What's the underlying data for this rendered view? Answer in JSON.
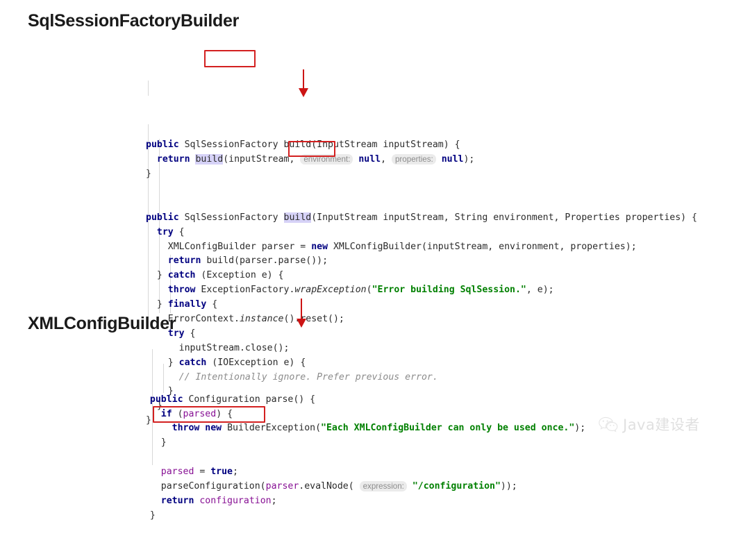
{
  "page": {
    "watermark_text": "Java建设者",
    "watermark_icon": "wechat-logo-icon",
    "accent_color": "#cc1414",
    "annotation_box_color": "#d32020",
    "keyword_color": "#000080",
    "string_color": "#008000",
    "comment_color": "#8c8c8c",
    "field_color": "#871094",
    "highlight_color": "#d6d2f7",
    "inlay_hint_bg": "#ebebeb",
    "background_color": "#ffffff"
  },
  "sections": [
    {
      "id": "sqlsessionfactorybuilder",
      "title": "SqlSessionFactoryBuilder"
    },
    {
      "id": "xmlconfigbuilder",
      "title": "XMLConfigBuilder"
    }
  ],
  "annotations": {
    "box_build": "build(i",
    "box_parse": "parse()",
    "box_parse_configuration": "parseConfiguration",
    "arrow_1": "build-method-overload-arrow",
    "arrow_2": "parse-method-arrow"
  },
  "code_factory": {
    "lines": [
      {
        "tokens": [
          {
            "t": "public",
            "c": "kw"
          },
          {
            "t": " SqlSessionFactory build(InputStream inputStream) {",
            "c": "plain"
          }
        ]
      },
      {
        "tokens": [
          {
            "t": "  ",
            "c": "plain"
          },
          {
            "t": "return",
            "c": "kw"
          },
          {
            "t": " ",
            "c": "plain"
          },
          {
            "t": "build",
            "c": "hl-build"
          },
          {
            "t": "(inputStream, ",
            "c": "plain"
          },
          {
            "t": "environment:",
            "c": "hint"
          },
          {
            "t": " ",
            "c": "plain"
          },
          {
            "t": "null",
            "c": "kw"
          },
          {
            "t": ", ",
            "c": "plain"
          },
          {
            "t": "properties:",
            "c": "hint"
          },
          {
            "t": " ",
            "c": "plain"
          },
          {
            "t": "null",
            "c": "kw"
          },
          {
            "t": ");",
            "c": "plain"
          }
        ]
      },
      {
        "tokens": [
          {
            "t": "}",
            "c": "plain"
          }
        ]
      },
      {
        "tokens": [
          {
            "t": "",
            "c": "plain"
          }
        ]
      },
      {
        "tokens": [
          {
            "t": "",
            "c": "plain"
          }
        ]
      },
      {
        "tokens": [
          {
            "t": "public",
            "c": "kw"
          },
          {
            "t": " SqlSessionFactory ",
            "c": "plain"
          },
          {
            "t": "build",
            "c": "hl-build"
          },
          {
            "t": "(InputStream inputStream, String environment, Properties properties) {",
            "c": "plain"
          }
        ]
      },
      {
        "tokens": [
          {
            "t": "  ",
            "c": "plain"
          },
          {
            "t": "try",
            "c": "kw"
          },
          {
            "t": " {",
            "c": "plain"
          }
        ]
      },
      {
        "tokens": [
          {
            "t": "    XMLConfigBuilder parser = ",
            "c": "plain"
          },
          {
            "t": "new",
            "c": "kw"
          },
          {
            "t": " XMLConfigBuilder(inputStream, environment, properties);",
            "c": "plain"
          }
        ]
      },
      {
        "tokens": [
          {
            "t": "    ",
            "c": "plain"
          },
          {
            "t": "return",
            "c": "kw"
          },
          {
            "t": " build(parser.parse());",
            "c": "plain"
          }
        ]
      },
      {
        "tokens": [
          {
            "t": "  } ",
            "c": "plain"
          },
          {
            "t": "catch",
            "c": "kw"
          },
          {
            "t": " (Exception e) {",
            "c": "plain"
          }
        ]
      },
      {
        "tokens": [
          {
            "t": "    ",
            "c": "plain"
          },
          {
            "t": "throw",
            "c": "kw"
          },
          {
            "t": " ExceptionFactory.",
            "c": "plain"
          },
          {
            "t": "wrapException",
            "c": "mtd-i"
          },
          {
            "t": "(",
            "c": "plain"
          },
          {
            "t": "\"Error building SqlSession.\"",
            "c": "str"
          },
          {
            "t": ", e);",
            "c": "plain"
          }
        ]
      },
      {
        "tokens": [
          {
            "t": "  } ",
            "c": "plain"
          },
          {
            "t": "finally",
            "c": "kw"
          },
          {
            "t": " {",
            "c": "plain"
          }
        ]
      },
      {
        "tokens": [
          {
            "t": "    ErrorContext.",
            "c": "plain"
          },
          {
            "t": "instance",
            "c": "mtd-i"
          },
          {
            "t": "().reset();",
            "c": "plain"
          }
        ]
      },
      {
        "tokens": [
          {
            "t": "    ",
            "c": "plain"
          },
          {
            "t": "try",
            "c": "kw"
          },
          {
            "t": " {",
            "c": "plain"
          }
        ]
      },
      {
        "tokens": [
          {
            "t": "      inputStream.close();",
            "c": "plain"
          }
        ]
      },
      {
        "tokens": [
          {
            "t": "    } ",
            "c": "plain"
          },
          {
            "t": "catch",
            "c": "kw"
          },
          {
            "t": " (IOException e) {",
            "c": "plain"
          }
        ]
      },
      {
        "tokens": [
          {
            "t": "      ",
            "c": "plain"
          },
          {
            "t": "// Intentionally ignore. Prefer previous error.",
            "c": "cmt"
          }
        ]
      },
      {
        "tokens": [
          {
            "t": "    }",
            "c": "plain"
          }
        ]
      },
      {
        "tokens": [
          {
            "t": "  }",
            "c": "plain"
          }
        ]
      },
      {
        "tokens": [
          {
            "t": "}",
            "c": "plain"
          }
        ]
      }
    ]
  },
  "code_config": {
    "lines": [
      {
        "tokens": [
          {
            "t": "  ",
            "c": "plain"
          },
          {
            "t": "public",
            "c": "kw"
          },
          {
            "t": " Configuration parse() {",
            "c": "plain"
          }
        ]
      },
      {
        "tokens": [
          {
            "t": "    ",
            "c": "plain"
          },
          {
            "t": "if",
            "c": "kw"
          },
          {
            "t": " (",
            "c": "plain"
          },
          {
            "t": "parsed",
            "c": "fld"
          },
          {
            "t": ") {",
            "c": "plain"
          }
        ]
      },
      {
        "tokens": [
          {
            "t": "      ",
            "c": "plain"
          },
          {
            "t": "throw",
            "c": "kw"
          },
          {
            "t": " ",
            "c": "plain"
          },
          {
            "t": "new",
            "c": "kw"
          },
          {
            "t": " BuilderException(",
            "c": "plain"
          },
          {
            "t": "\"Each XMLConfigBuilder can only be used once.\"",
            "c": "str"
          },
          {
            "t": ");",
            "c": "plain"
          }
        ]
      },
      {
        "tokens": [
          {
            "t": "    }",
            "c": "plain"
          }
        ]
      },
      {
        "tokens": [
          {
            "t": "",
            "c": "plain"
          }
        ]
      },
      {
        "tokens": [
          {
            "t": "    ",
            "c": "plain"
          },
          {
            "t": "parsed",
            "c": "fld"
          },
          {
            "t": " = ",
            "c": "plain"
          },
          {
            "t": "true",
            "c": "kw"
          },
          {
            "t": ";",
            "c": "plain"
          }
        ]
      },
      {
        "tokens": [
          {
            "t": "    parseConfiguration(",
            "c": "plain"
          },
          {
            "t": "parser",
            "c": "fld"
          },
          {
            "t": ".evalNode( ",
            "c": "plain"
          },
          {
            "t": "expression:",
            "c": "hint"
          },
          {
            "t": " ",
            "c": "plain"
          },
          {
            "t": "\"/configuration\"",
            "c": "str"
          },
          {
            "t": "));",
            "c": "plain"
          }
        ]
      },
      {
        "tokens": [
          {
            "t": "    ",
            "c": "plain"
          },
          {
            "t": "return",
            "c": "kw"
          },
          {
            "t": " ",
            "c": "plain"
          },
          {
            "t": "configuration",
            "c": "fld"
          },
          {
            "t": ";",
            "c": "plain"
          }
        ]
      },
      {
        "tokens": [
          {
            "t": "  }",
            "c": "plain"
          }
        ]
      }
    ]
  }
}
